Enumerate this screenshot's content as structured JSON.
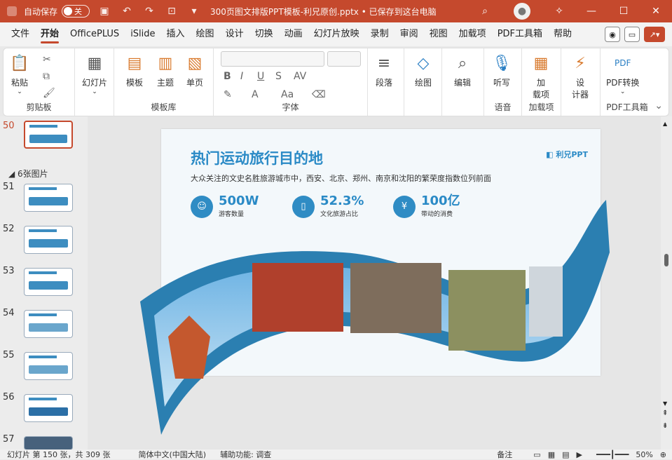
{
  "titlebar": {
    "autosave_label": "自动保存",
    "autosave_state": "关",
    "doc_title": "300页图文排版PPT模板-利兄原创.pptx • 已保存到这台电脑",
    "accent_color": "#c5492d"
  },
  "menu": {
    "tabs": [
      "文件",
      "开始",
      "OfficePLUS",
      "iSlide",
      "插入",
      "绘图",
      "设计",
      "切换",
      "动画",
      "幻灯片放映",
      "录制",
      "审阅",
      "视图",
      "加载项",
      "PDF工具箱",
      "帮助"
    ],
    "active": "开始"
  },
  "ribbon": {
    "clipboard": {
      "paste": "粘贴",
      "group": "剪贴板"
    },
    "slides": {
      "new_slide": "幻灯片",
      "group": ""
    },
    "templates": {
      "template": "模板",
      "theme": "主题",
      "single": "单页",
      "group": "模板库"
    },
    "font": {
      "group": "字体"
    },
    "paragraph": {
      "label": "段落"
    },
    "drawing": {
      "label": "绘图"
    },
    "editing": {
      "label": "编辑"
    },
    "voice": {
      "dictate": "听写",
      "group": "语音"
    },
    "addins": {
      "label_line1": "加",
      "label_line2": "载项",
      "group": "加载项"
    },
    "designer": {
      "line1": "设",
      "line2": "计器"
    },
    "pdf": {
      "label": "PDF转换",
      "group": "PDF工具箱"
    }
  },
  "sidebar": {
    "section_label": "6张图片",
    "slides": [
      {
        "num": "50",
        "selected": true
      },
      {
        "num": "51"
      },
      {
        "num": "52"
      },
      {
        "num": "53"
      },
      {
        "num": "54"
      },
      {
        "num": "55"
      },
      {
        "num": "56"
      },
      {
        "num": "57"
      }
    ]
  },
  "slide": {
    "title": "热门运动旅行目的地",
    "brand": "利兄PPT",
    "subtitle": "大众关注的文史名胜旅游城市中，西安、北京、郑州、南京和沈阳的繁荣度指数位列前面",
    "stats": [
      {
        "value": "500W",
        "label": "游客数量",
        "icon": "user-icon"
      },
      {
        "value": "52.3%",
        "label": "文化旅游占比",
        "icon": "book-icon"
      },
      {
        "value": "100亿",
        "label": "带动的消费",
        "icon": "money-icon"
      }
    ]
  },
  "status": {
    "slide_info": "幻灯片 第 150 张，共 309 张",
    "language": "简体中文(中国大陆)",
    "accessibility": "辅助功能: 调查",
    "notes": "备注",
    "zoom": "50%"
  }
}
